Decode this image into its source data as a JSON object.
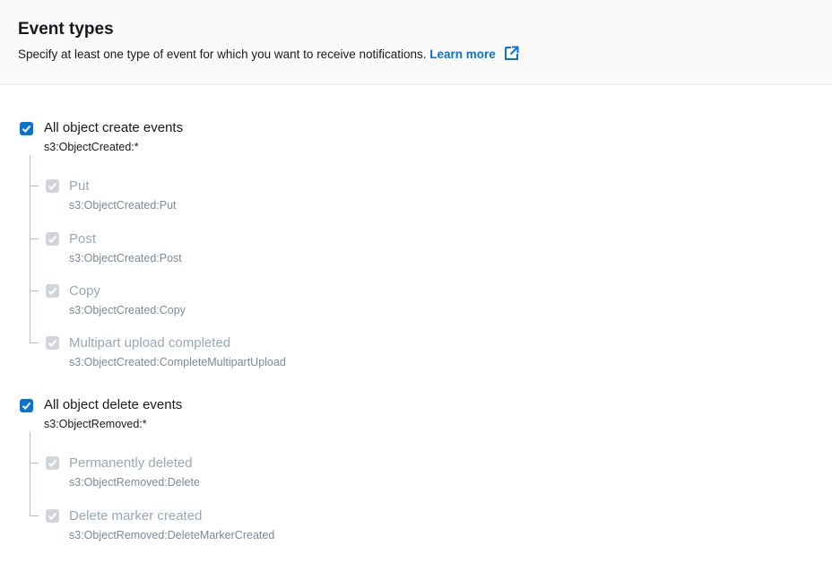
{
  "header": {
    "title": "Event types",
    "description": "Specify at least one type of event for which you want to receive notifications.",
    "learn_more": "Learn more",
    "external_icon": "external-link-icon"
  },
  "colors": {
    "accent": "#0972d3",
    "disabled_check": "#d1d5db",
    "disabled_text": "#9ba7b6",
    "tree_line": "#b6bec9"
  },
  "create_group": {
    "label": "All object create events",
    "event": "s3:ObjectCreated:*",
    "checked": true,
    "children": [
      {
        "label": "Put",
        "event": "s3:ObjectCreated:Put",
        "checked": true,
        "disabled": true
      },
      {
        "label": "Post",
        "event": "s3:ObjectCreated:Post",
        "checked": true,
        "disabled": true
      },
      {
        "label": "Copy",
        "event": "s3:ObjectCreated:Copy",
        "checked": true,
        "disabled": true
      },
      {
        "label": "Multipart upload completed",
        "event": "s3:ObjectCreated:CompleteMultipartUpload",
        "checked": true,
        "disabled": true
      }
    ]
  },
  "delete_group": {
    "label": "All object delete events",
    "event": "s3:ObjectRemoved:*",
    "checked": true,
    "children": [
      {
        "label": "Permanently deleted",
        "event": "s3:ObjectRemoved:Delete",
        "checked": true,
        "disabled": true
      },
      {
        "label": "Delete marker created",
        "event": "s3:ObjectRemoved:DeleteMarkerCreated",
        "checked": true,
        "disabled": true
      }
    ]
  }
}
